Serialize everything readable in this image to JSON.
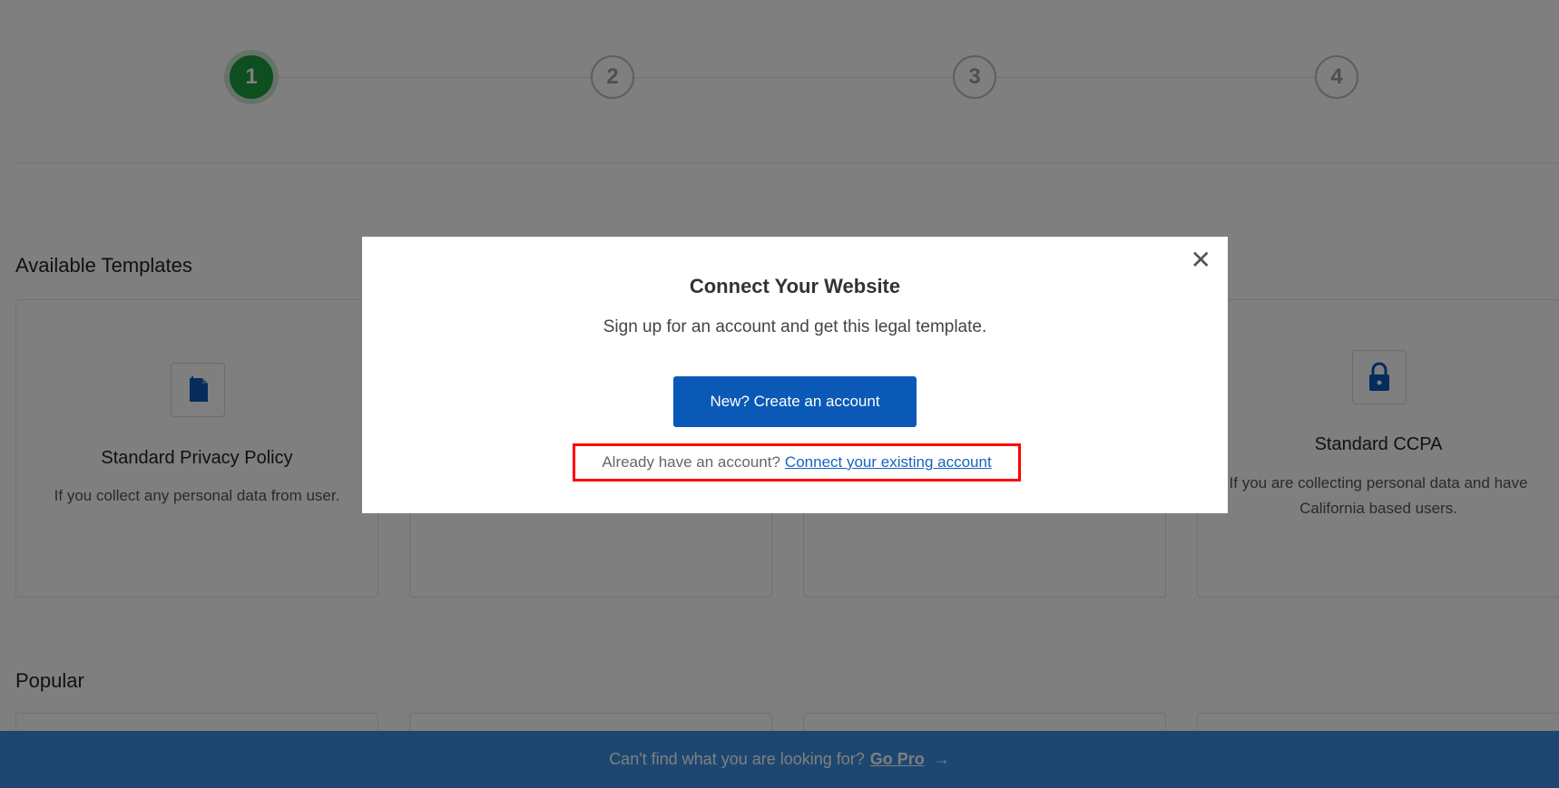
{
  "stepper": {
    "steps": [
      "1",
      "2",
      "3",
      "4"
    ],
    "active_step": 1
  },
  "available_templates": {
    "title": "Available Templates",
    "cards": [
      {
        "title": "Standard Privacy Policy",
        "desc": "If you collect any personal data from user.",
        "icon": "document-clip-icon"
      },
      {
        "title": "",
        "desc": ""
      },
      {
        "title": "",
        "desc": ""
      },
      {
        "title": "Standard CCPA",
        "desc": "If you are collecting personal data and have California based users.",
        "icon": "lock-icon"
      }
    ]
  },
  "popular": {
    "title": "Popular"
  },
  "bottom_bar": {
    "text": "Can't find what you are looking for?",
    "link": "Go Pro",
    "arrow_icon": "arrow-right-icon"
  },
  "modal": {
    "title": "Connect Your Website",
    "subtitle": "Sign up for an account and get this legal template.",
    "create_button": "New? Create an account",
    "existing_prompt": "Already have an account?",
    "existing_link": "Connect your existing account",
    "close_icon": "close-icon"
  },
  "colors": {
    "primary": "#0a59b6",
    "step_active": "#1b9e3e",
    "bar": "#3b8fe0",
    "highlight": "#ff0000"
  }
}
